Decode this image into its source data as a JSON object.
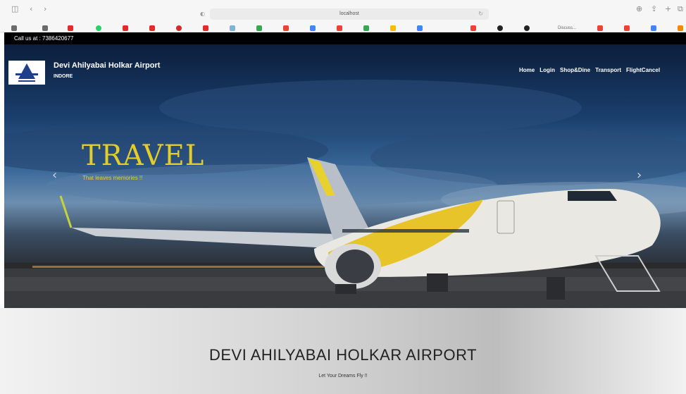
{
  "browser": {
    "url": "localhost",
    "bookmarks": [
      "Discuss..."
    ]
  },
  "header": {
    "call_text": "Call us at : 7386420677",
    "brand_name": "Devi Ahilyabai Holkar Airport",
    "city": "INDORE",
    "nav": [
      "Home",
      "Login",
      "Shop&Dine",
      "Transport",
      "FlightCancel"
    ]
  },
  "hero": {
    "headline": "TRAVEL",
    "tagline": "That leaves memories !!",
    "prev_icon": "chevron-left-icon",
    "next_icon": "chevron-right-icon"
  },
  "section": {
    "title": "DEVI AHILYABAI HOLKAR AIRPORT",
    "subtitle": "Let Your Dreams Fly !!"
  },
  "colors": {
    "headline": "#e3cd2a",
    "topstrip": "#000000"
  }
}
